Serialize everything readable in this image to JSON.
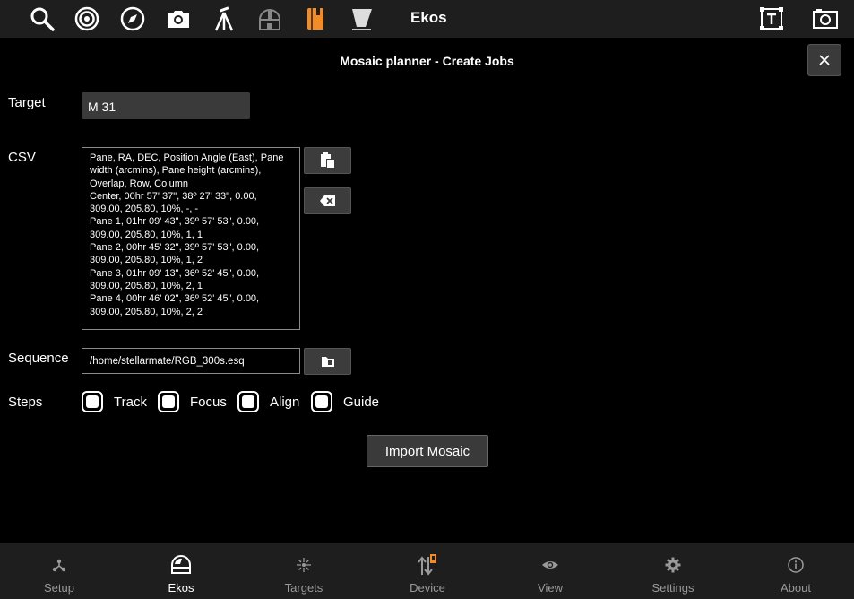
{
  "app": {
    "title": "Ekos",
    "toolbar_icons": [
      "search-icon",
      "target-icon",
      "compass-icon",
      "camera-icon",
      "tripod-icon",
      "observatory-icon",
      "notebook-icon",
      "flat-panel-icon"
    ],
    "right_icons": [
      "text-frame-icon",
      "screenshot-icon"
    ]
  },
  "dialog": {
    "title": "Mosaic planner - Create Jobs",
    "target": {
      "label": "Target",
      "value": "M 31"
    },
    "csv": {
      "label": "CSV",
      "text": "Pane, RA, DEC, Position Angle (East), Pane width (arcmins), Pane height (arcmins), Overlap, Row, Column\nCenter, 00hr 57' 37\", 38º 27' 33\", 0.00, 309.00, 205.80, 10%, -, -\nPane 1, 01hr 09' 43\", 39º 57' 53\", 0.00, 309.00, 205.80, 10%, 1, 1\nPane 2, 00hr 45' 32\", 39º 57' 53\", 0.00, 309.00, 205.80, 10%, 1, 2\nPane 3, 01hr 09' 13\", 36º 52' 45\", 0.00, 309.00, 205.80, 10%, 2, 1\nPane 4, 00hr 46' 02\", 36º 52' 45\", 0.00, 309.00, 205.80, 10%, 2, 2"
    },
    "sequence": {
      "label": "Sequence",
      "value": "/home/stellarmate/RGB_300s.esq"
    },
    "steps": {
      "label": "Steps",
      "items": [
        {
          "label": "Track",
          "checked": false
        },
        {
          "label": "Focus",
          "checked": false
        },
        {
          "label": "Align",
          "checked": false
        },
        {
          "label": "Guide",
          "checked": false
        }
      ]
    },
    "import_label": "Import Mosaic"
  },
  "nav": {
    "items": [
      {
        "label": "Setup",
        "icon": "setup-icon"
      },
      {
        "label": "Ekos",
        "icon": "ekos-icon",
        "active": true
      },
      {
        "label": "Targets",
        "icon": "targets-icon"
      },
      {
        "label": "Device",
        "icon": "device-icon"
      },
      {
        "label": "View",
        "icon": "eye-icon"
      },
      {
        "label": "Settings",
        "icon": "gear-icon"
      },
      {
        "label": "About",
        "icon": "info-icon"
      }
    ]
  },
  "colors": {
    "accent": "#f28c28",
    "toolbar_bg": "#1e1e1e",
    "button_bg": "#3a3a3a"
  }
}
